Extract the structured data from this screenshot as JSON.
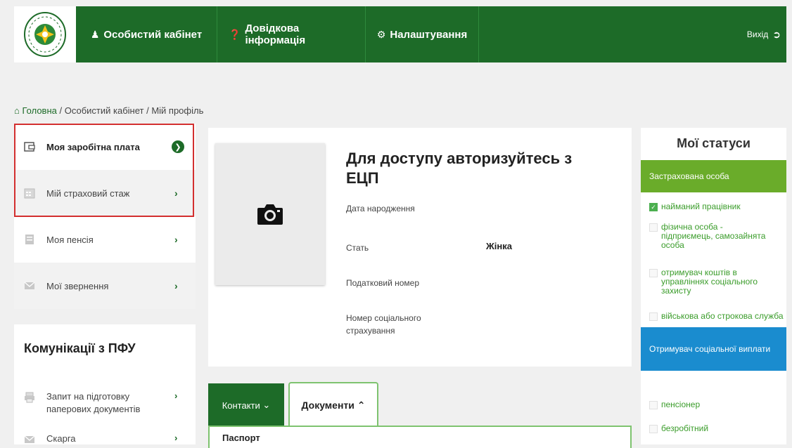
{
  "header": {
    "cabinet": "Особистий кабінет",
    "help": "Довідкова інформація",
    "settings": "Налаштування",
    "exit": "Вихід"
  },
  "breadcrumb": {
    "home": "Головна",
    "trail": " / Особистий кабінет / Мій профіль"
  },
  "sidebar": {
    "items": [
      {
        "label": "Моя заробітна плата",
        "icon": "wallet-icon"
      },
      {
        "label": "Мій страховий стаж",
        "icon": "calendar-icon"
      },
      {
        "label": "Моя пенсія",
        "icon": "document-stack-icon"
      },
      {
        "label": "Мої звернення",
        "icon": "envelope-icon"
      }
    ]
  },
  "communications": {
    "title": "Комунікації з ПФУ",
    "items": [
      {
        "label": "Запит на підготовку паперових документів",
        "icon": "printer-icon"
      },
      {
        "label": "Скарга",
        "icon": "envelope-icon"
      }
    ]
  },
  "profile": {
    "title": "Для доступу авторизуйтесь з ЕЦП",
    "birth_label": "Дата народження",
    "gender_label": "Стать",
    "gender_value": "Жінка",
    "tax_label": "Податковий номер",
    "social_label": "Номер соціального страхування"
  },
  "tabs": {
    "contacts": "Контакти",
    "documents": "Документи",
    "panel_text": "Паспорт"
  },
  "statuses": {
    "title": "Мої статуси",
    "insured_header": "Застрахована особа",
    "insured_items": [
      {
        "label": "найманий працівник",
        "checked": true
      },
      {
        "label": "фізична особа - підприємець, самозайнята особа",
        "checked": false
      },
      {
        "label": "отримувач коштів в управліннях соціального захисту",
        "checked": false
      },
      {
        "label": "військова або строкова служба",
        "checked": false
      }
    ],
    "recipient_header": "Отримувач соціальної виплати",
    "recipient_items": [
      {
        "label": "пенсіонер",
        "checked": false
      },
      {
        "label": "безробітний",
        "checked": false
      }
    ]
  },
  "colors": {
    "brand_green": "#1d6b28",
    "status_green": "#6aac2a",
    "status_blue": "#1a8ccf",
    "highlight_red": "#d32f2f"
  }
}
